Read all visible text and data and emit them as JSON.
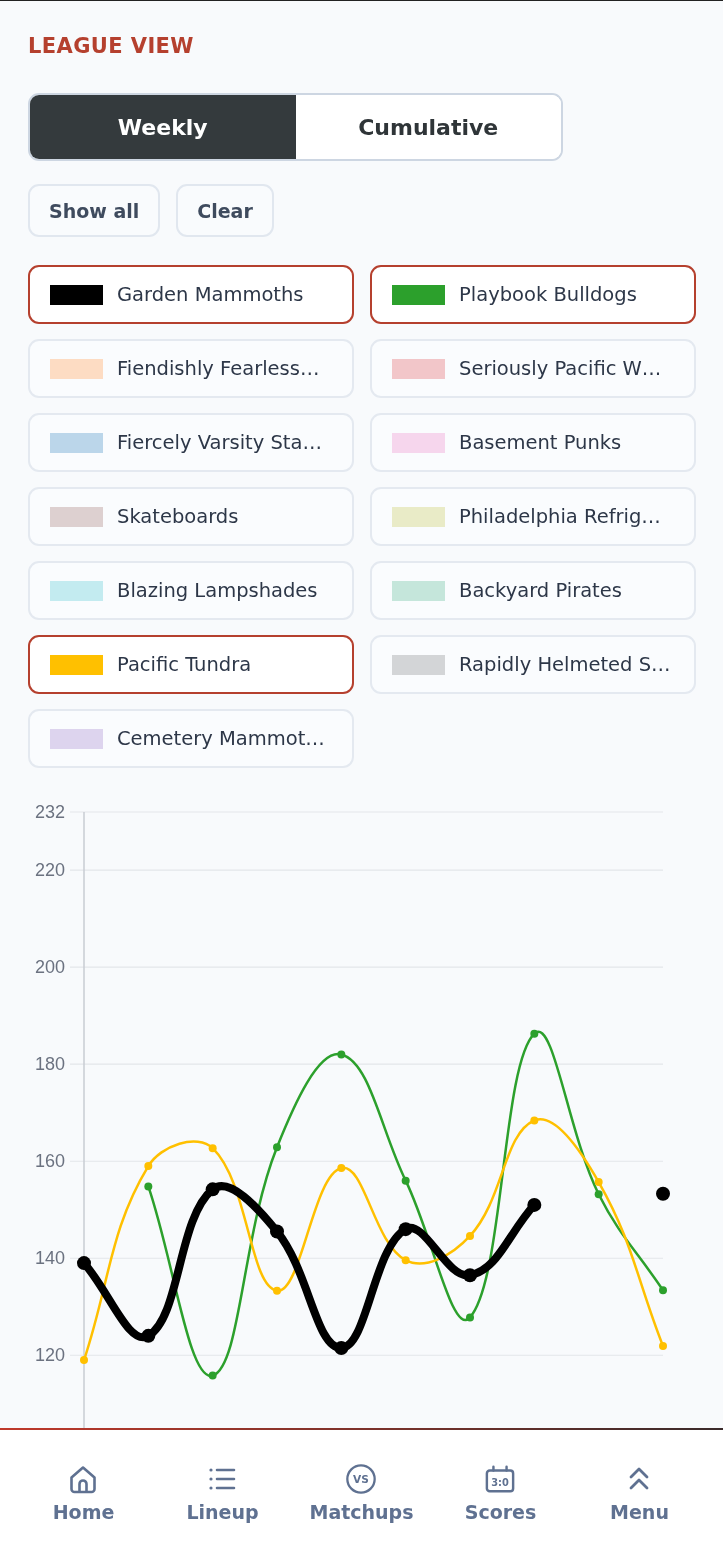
{
  "title": "LEAGUE VIEW",
  "view_tabs": [
    {
      "label": "Weekly",
      "selected": true
    },
    {
      "label": "Cumulative",
      "selected": false
    }
  ],
  "actions": [
    "Show all",
    "Clear"
  ],
  "teams": [
    {
      "name": "Garden Mammoths",
      "color": "#000000",
      "selected": true
    },
    {
      "name": "Playbook Bulldogs",
      "color": "#2ca02c",
      "selected": true
    },
    {
      "name": "Fiendishly Fearless…",
      "color": "#fddcc3",
      "selected": false
    },
    {
      "name": "Seriously Pacific W…",
      "color": "#f2c6c9",
      "selected": false
    },
    {
      "name": "Fiercely Varsity Sta…",
      "color": "#bbd6ea",
      "selected": false
    },
    {
      "name": "Basement Punks",
      "color": "#f6d6ed",
      "selected": false
    },
    {
      "name": "Skateboards",
      "color": "#ddd0d0",
      "selected": false
    },
    {
      "name": "Philadelphia Refrig…",
      "color": "#e9ebc7",
      "selected": false
    },
    {
      "name": "Blazing Lampshades",
      "color": "#c3ebf0",
      "selected": false
    },
    {
      "name": "Backyard Pirates",
      "color": "#c5e6db",
      "selected": false
    },
    {
      "name": "Pacific Tundra",
      "color": "#ffc000",
      "selected": true
    },
    {
      "name": "Rapidly Helmeted S…",
      "color": "#d3d5d7",
      "selected": false
    },
    {
      "name": "Cemetery Mammot…",
      "color": "#ddd4ee",
      "selected": false
    }
  ],
  "chart": {
    "line_styles": [
      {
        "kind": "bold"
      },
      {
        "kind": "plain"
      },
      {
        "kind": "plain"
      }
    ],
    "chart_data": {
      "type": "line",
      "grid": true,
      "ylim": [
        105,
        232
      ],
      "yticks": [
        120,
        140,
        160,
        180,
        200,
        220,
        232
      ],
      "series": [
        {
          "color": "#000000",
          "marker": "o",
          "values": [
            139,
            124,
            154.2,
            145.5,
            121.5,
            146,
            136.5,
            151,
            null,
            153.3
          ]
        },
        {
          "color": "#2ca02c",
          "marker": "o",
          "values": [
            null,
            154.8,
            115.8,
            162.9,
            182,
            156,
            127.8,
            186.3,
            153.2,
            133.4
          ]
        },
        {
          "color": "#ffc000",
          "marker": "o",
          "values": [
            119,
            159,
            162.7,
            133.3,
            158.6,
            139.6,
            144.6,
            168.4,
            155.7,
            121.9
          ]
        }
      ]
    }
  },
  "nav": [
    {
      "kind": "home",
      "label": "Home"
    },
    {
      "kind": "list",
      "label": "Lineup"
    },
    {
      "kind": "versus",
      "label": "Matchups",
      "icon_text": "VS"
    },
    {
      "kind": "scoreboard",
      "label": "Scores",
      "icon_text": "3:0"
    },
    {
      "kind": "chevrons",
      "label": "Menu"
    }
  ]
}
